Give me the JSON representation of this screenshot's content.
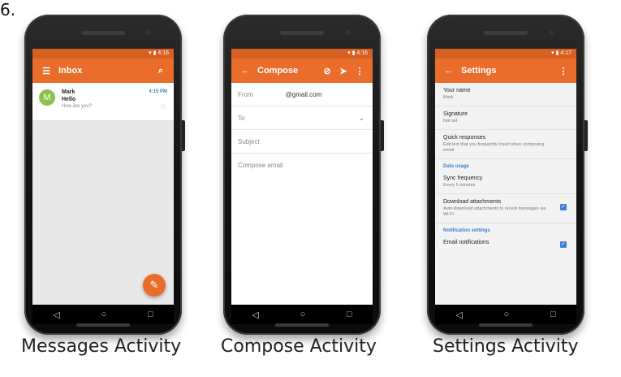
{
  "figure_label": "6.",
  "captions": [
    "Messages Activity",
    "Compose Activity",
    "Settings Activity"
  ],
  "colors": {
    "accent": "#ea6d2b",
    "status": "#d75f21",
    "link": "#3f7fd1"
  },
  "phones": {
    "inbox": {
      "status_time": "4:16",
      "title": "Inbox",
      "message": {
        "avatar": "M",
        "from": "Mark",
        "subject": "Hello",
        "snippet": "How are you?",
        "time": "4:15 PM"
      }
    },
    "compose": {
      "status_time": "4:16",
      "title": "Compose",
      "from_label": "From",
      "from_value": "@gmail.com",
      "to_label": "To",
      "subject_placeholder": "Subject",
      "body_placeholder": "Compose email"
    },
    "settings": {
      "status_time": "4:17",
      "title": "Settings",
      "rows": [
        {
          "title": "Your name",
          "subtitle": "Mark"
        },
        {
          "title": "Signature",
          "subtitle": "Not set"
        },
        {
          "title": "Quick responses",
          "subtitle": "Edit text that you frequently insert when composing email"
        }
      ],
      "section_data": "Data usage",
      "sync": {
        "title": "Sync frequency",
        "subtitle": "Every 5 minutes"
      },
      "download": {
        "title": "Download attachments",
        "subtitle": "Auto-download attachments to recent messages via Wi-Fi"
      },
      "section_notify": "Notification settings",
      "email_notif": {
        "title": "Email notifications"
      }
    }
  }
}
